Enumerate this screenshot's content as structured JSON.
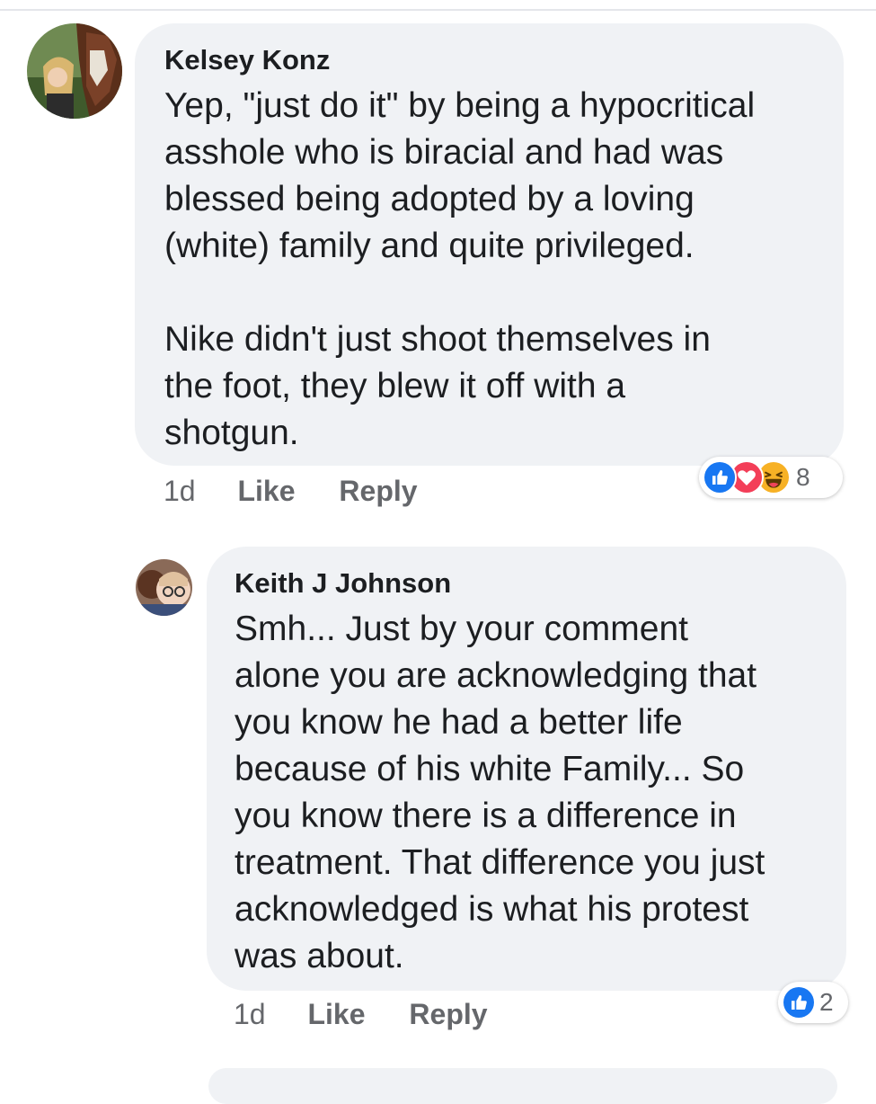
{
  "comments": [
    {
      "author": "Kelsey Konz",
      "text": "Yep, \"just do it\" by being a hypocritical\nasshole who is biracial and had was\nblessed being adopted by a loving\n(white) family and quite privileged.\n\nNike didn't just shoot themselves in\nthe foot, they blew it off with a\nshotgun.",
      "time": "1d",
      "like_label": "Like",
      "reply_label": "Reply",
      "reaction_count": "8",
      "reactions": [
        "like-icon",
        "love-icon",
        "haha-icon"
      ]
    },
    {
      "author": "Keith J Johnson",
      "text": "Smh... Just by your comment\nalone you are acknowledging that\nyou know he had a better life\nbecause of his white Family... So\nyou know there is a difference in\ntreatment. That difference you just\nacknowledged is what his protest\nwas about.",
      "time": "1d",
      "like_label": "Like",
      "reply_label": "Reply",
      "reaction_count": "2",
      "reactions": [
        "like-icon"
      ]
    }
  ],
  "colors": {
    "bubble": "#f0f2f5",
    "muted_text": "#65676b",
    "like_blue": "#1877f2",
    "love_red": "#f33e58",
    "haha_yellow": "#f7b125"
  }
}
